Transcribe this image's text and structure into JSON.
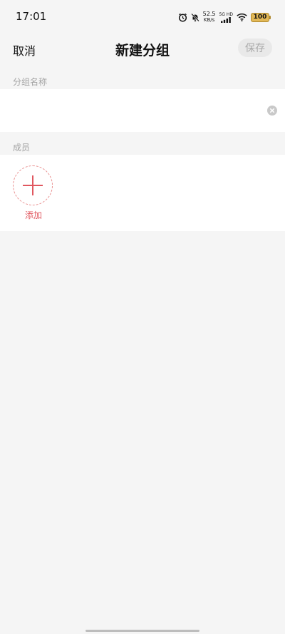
{
  "status_bar": {
    "time": "17:01",
    "net_speed_value": "52.5",
    "net_speed_unit": "KB/s",
    "signal_label": "5G HD",
    "battery": "100",
    "icons": [
      "alarm-icon",
      "bell-off-icon",
      "signal-bars-icon",
      "wifi-icon",
      "battery-icon"
    ]
  },
  "nav": {
    "cancel_label": "取消",
    "title": "新建分组",
    "save_label": "保存"
  },
  "group_name": {
    "section_label": "分组名称",
    "value": "",
    "clear_icon": "clear-icon"
  },
  "members": {
    "section_label": "成员",
    "add_label": "添加",
    "add_icon": "plus-icon"
  },
  "colors": {
    "background": "#f5f5f5",
    "card": "#ffffff",
    "accent": "#e0575f",
    "muted": "#a3a3a3",
    "battery": "#e2b857"
  }
}
